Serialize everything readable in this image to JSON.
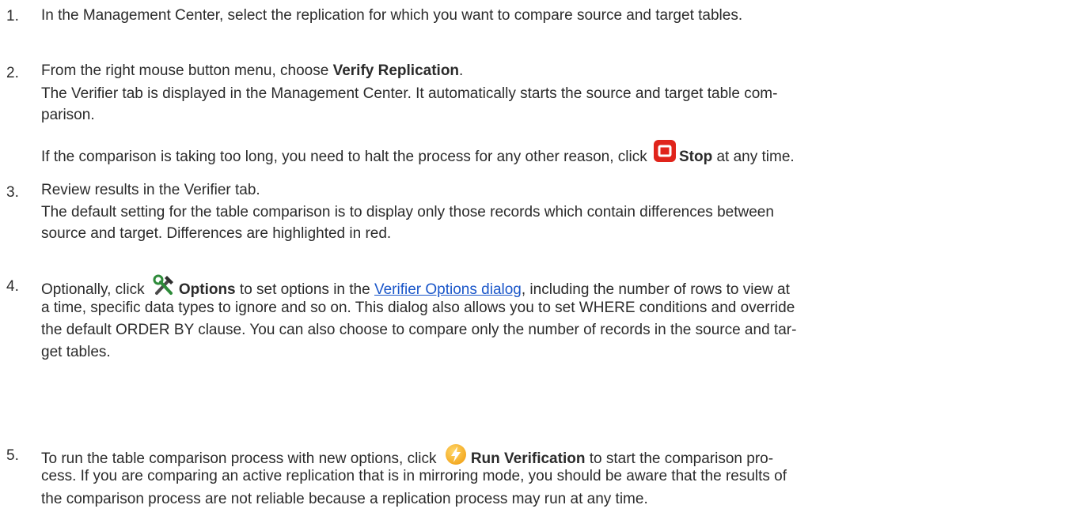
{
  "steps": [
    {
      "num": "1.",
      "lines": [
        [
          "In the Management Center, select the replication for which you want to compare source and target tables."
        ]
      ]
    },
    {
      "num": "2.",
      "l1a": "From the right mouse button menu, choose ",
      "l1b": "Verify Replication",
      "l1c": ".",
      "l2": " The Verifier tab is displayed in the Management Center.  It automatically starts the source and target table com-",
      "l3": "parison.",
      "l4a": " If the comparison is taking too long, you need to halt the process for any other reason, click ",
      "l4b": "Stop",
      "l4c": " at any time."
    },
    {
      "num": "3.",
      "l1": "Review results in the Verifier tab.",
      "l2": " The default setting for the table comparison is to display only those records which contain differences between",
      "l3": "source and target. Differences are highlighted in red."
    },
    {
      "num": "4.",
      "l1a": "Optionally, click ",
      "l1b": "Options",
      "l1c": " to set options in the ",
      "l1link": "Verifier Options dialog",
      "l1d": ", including the number of rows to view at",
      "l2": "a time, specific data types to ignore and so on. This dialog also allows you to set WHERE conditions and override",
      "l3": "the default ORDER BY clause. You can also choose to compare only the number of records in the source and tar-",
      "l4": "get tables."
    },
    {
      "num": "5.",
      "l1a": "To run the table comparison process with new options, click ",
      "l1b": "Run Verification",
      "l1c": " to start the comparison pro-",
      "l2": "cess. If you are comparing an active replication that is in mirroring mode, you should be aware that the results of",
      "l3": "the comparison process are not reliable because a replication process may run at any time."
    }
  ],
  "icons": {
    "stop": "stop-icon",
    "options": "tools-icon",
    "run": "run-verification-icon",
    "stop_color": "#e0241b",
    "run_color": "#f2a51c"
  }
}
